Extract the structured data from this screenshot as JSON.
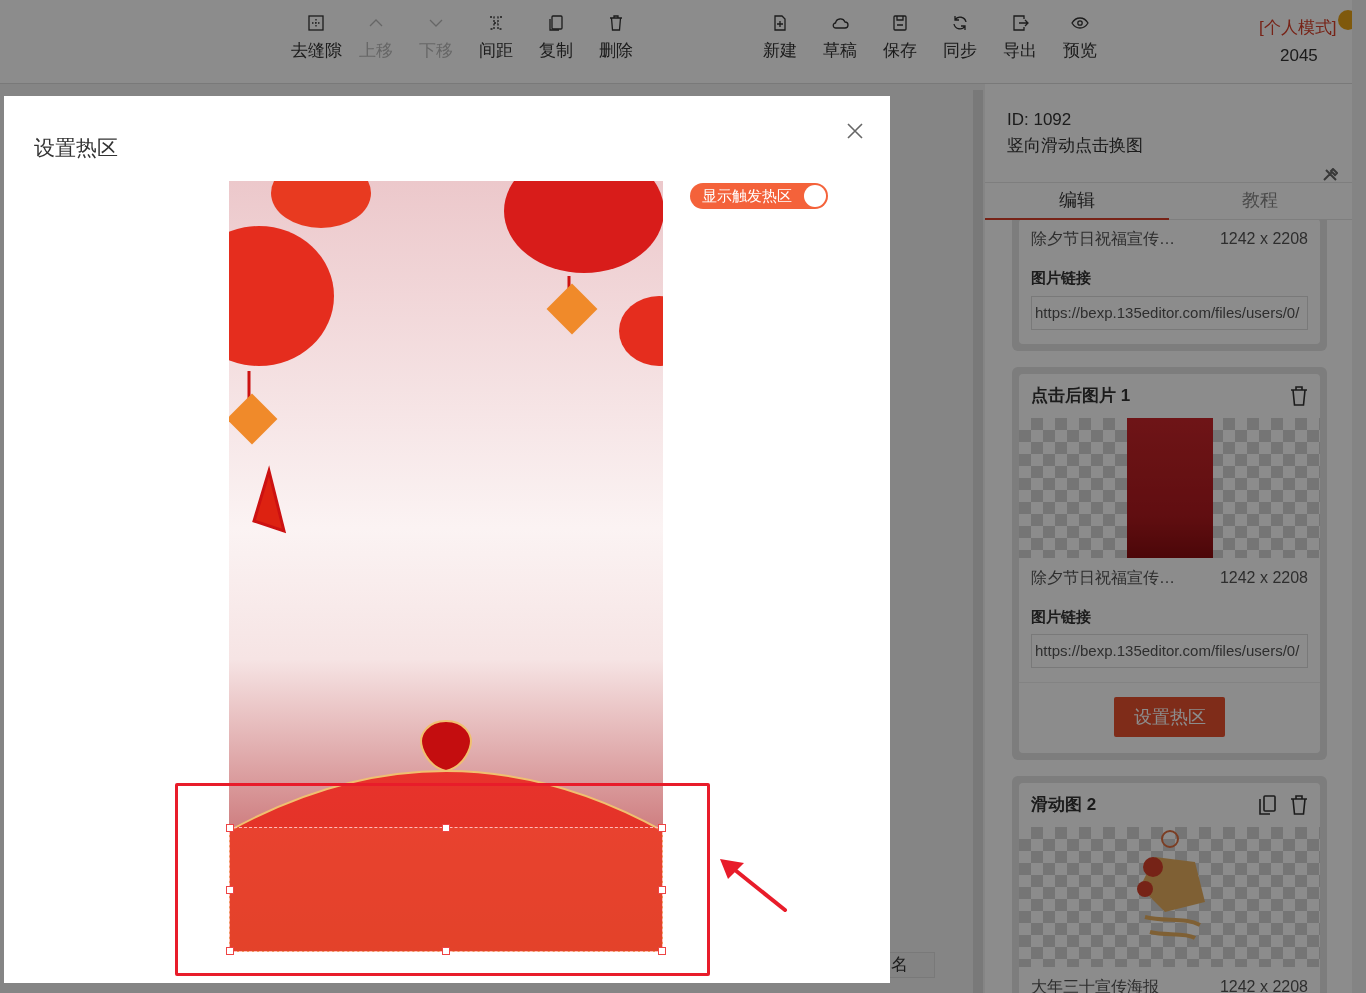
{
  "toolbar": {
    "groups": [
      [
        {
          "label": "去缝隙",
          "disabled": false
        },
        {
          "label": "上移",
          "disabled": true
        },
        {
          "label": "下移",
          "disabled": true
        },
        {
          "label": "间距",
          "disabled": false
        },
        {
          "label": "复制",
          "disabled": false
        },
        {
          "label": "删除",
          "disabled": false
        }
      ],
      [
        {
          "label": "新建",
          "disabled": false
        },
        {
          "label": "草稿",
          "disabled": false
        },
        {
          "label": "保存",
          "disabled": false
        },
        {
          "label": "同步",
          "disabled": false
        },
        {
          "label": "导出",
          "disabled": false
        },
        {
          "label": "预览",
          "disabled": false
        }
      ]
    ]
  },
  "account": {
    "mode": "[个人模式]",
    "count": "2045"
  },
  "panel": {
    "id": "ID: 1092",
    "title": "竖向滑动点击换图",
    "tabs": [
      {
        "label": "编辑",
        "selected": true
      },
      {
        "label": "教程",
        "selected": false
      }
    ],
    "cards": [
      {
        "kind": "partial",
        "file_name": "除夕节日祝福宣传…",
        "size": "1242 x 2208",
        "link_label": "图片链接",
        "link": "https://bexp.135editor.com/files/users/0/"
      },
      {
        "kind": "full",
        "title": "点击后图片 1",
        "copyable": false,
        "thumbnail": {
          "kind": "poster"
        },
        "file_name": "除夕节日祝福宣传…",
        "size": "1242 x 2208",
        "link_label": "图片链接",
        "link": "https://bexp.135editor.com/files/users/0/",
        "button": "设置热区"
      },
      {
        "kind": "full",
        "title": "滑动图 2",
        "copyable": true,
        "thumbnail": {
          "kind": "art"
        },
        "file_name": "大年三十宣传海报",
        "size": "1242 x 2208"
      }
    ]
  },
  "background_field": {
    "text": "名"
  },
  "dialog": {
    "title": "设置热区",
    "toggle": {
      "label": "显示触发热区",
      "on": true
    }
  }
}
